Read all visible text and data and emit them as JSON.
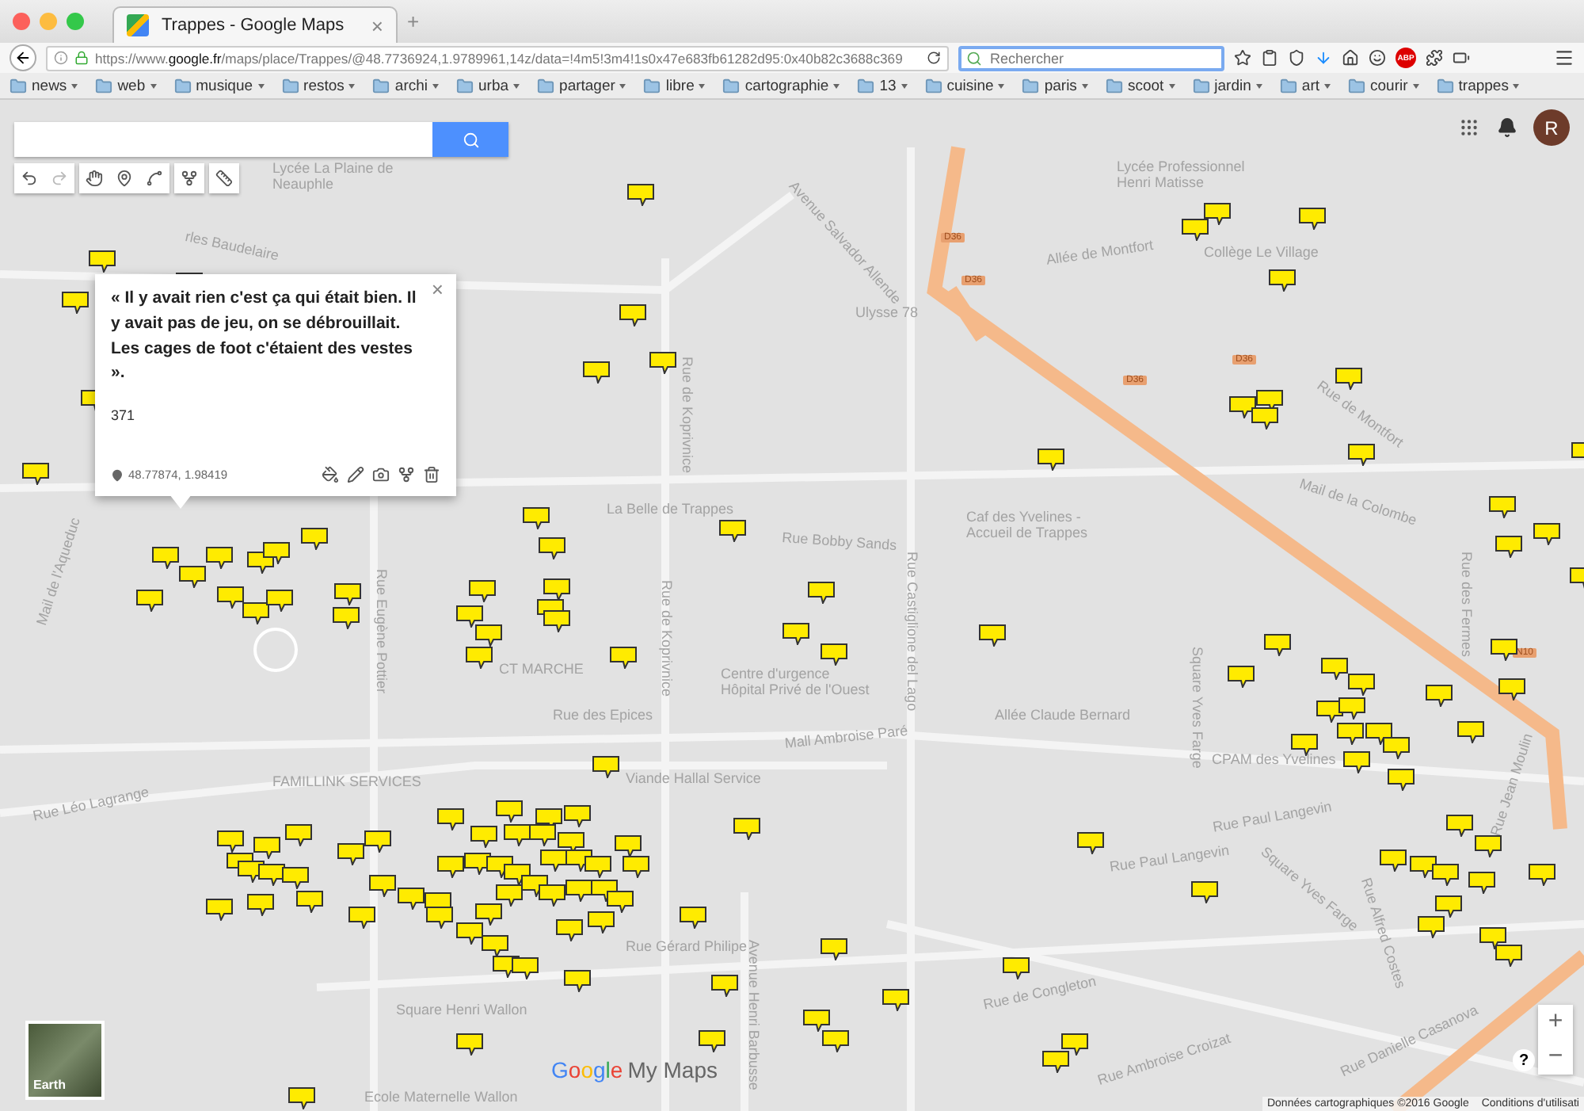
{
  "browser": {
    "tab": {
      "title": "Trappes - Google Maps",
      "close": "×"
    },
    "new_tab": "+",
    "url": "https://www.**google.fr**/maps/place/Trappes/@48.7736924,1.9789961,14z/data=!4m5!3m4!1s0x47e683fb61282d95:0x40b82c3688c369",
    "search": {
      "placeholder": "Rechercher"
    },
    "adblock_badge": "ABP",
    "bookmarks": [
      "news",
      "web",
      "musique",
      "restos",
      "archi",
      "urba",
      "partager",
      "libre",
      "cartographie",
      "13",
      "cuisine",
      "paris",
      "scoot",
      "jardin",
      "art",
      "courir",
      "trappes"
    ]
  },
  "map": {
    "account_initial": "R",
    "street_labels": [
      "Lycée La Plaine de Neauphle",
      "rles Baudelaire",
      "Avenue Salvador Allende",
      "Ulysse 78",
      "Allée de Montfort",
      "Collège Le Village",
      "Lycée Professionnel Henri Matisse",
      "Rue de Koprivnice",
      "Rue de Koprivnice",
      "La Belle de Trappes",
      "Rue Bobby Sands",
      "Caf des Yvelines - Accueil de Trappes",
      "Centre d'urgence Hôpital Privé de l'Ouest",
      "Rue Castiglione del Lago",
      "Rue des Epices",
      "Mall Ambroise Paré",
      "Allée Claude Bernard",
      "Square Yves Farge",
      "Square Yves Farge",
      "CPAM des Yvelines",
      "Rue Paul Langevin",
      "Rue Paul Langevin",
      "FAMILLINK SERVICES",
      "Viande Hallal Service",
      "Rue Léo Lagrange",
      "Rue Gérard Philipe",
      "Square Henri Wallon",
      "Ecole Maternelle Wallon",
      "Avenue Henri Barbusse",
      "Rue de Congleton",
      "Rue Ambroise Croizat",
      "Rue Danielle Casanova",
      "Rue Eugène Pottier",
      "Rue Jean Moulin",
      "Mail de l'Aqueduc",
      "Mail de la Colombe",
      "Rue des Fermes",
      "Rue de Montfort",
      "CT MARCHE",
      "Rue Alfred Costes"
    ],
    "road_badges": [
      "D36",
      "D36",
      "D36",
      "D36",
      "N10"
    ],
    "popup": {
      "text": "« Il y avait rien c'est ça qui était bien. Il y avait pas de jeu, on se débrouillait. Les cages de foot c'étaient des vestes ».",
      "number": "371",
      "coords": "48.77874, 1.98419",
      "close": "×"
    },
    "earth_label": "Earth",
    "logo": {
      "brand": "Google",
      "product": "My Maps"
    },
    "zoom": {
      "in": "+",
      "out": "−"
    },
    "help": "?",
    "footer": {
      "data": "Données cartographiques ©2016 Google",
      "terms": "Conditions d'utilisati"
    }
  }
}
